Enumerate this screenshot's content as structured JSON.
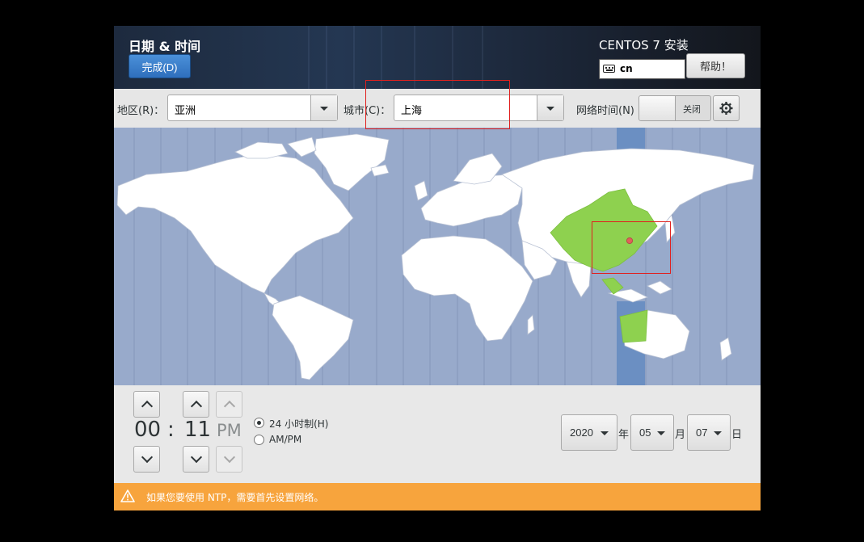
{
  "header": {
    "title": "日期 & 时间",
    "done_label": "完成(D)",
    "product_title": "CENTOS 7 安装",
    "keyboard_layout": "cn",
    "help_label": "帮助！"
  },
  "controls": {
    "region_label": "地区(R)：",
    "region_value": "亚洲",
    "city_label": "城市(C)：",
    "city_value": "上海",
    "network_time_label": "网络时间(N)",
    "network_time_state": "关闭",
    "network_time_on": false
  },
  "map": {
    "selected_city": "上海",
    "highlight_color": "#8ed14f",
    "ocean_color": "#98aacb",
    "land_color": "#ffffff",
    "current_zone_band_color": "#6b8fc2",
    "pin_color": "#e0625a"
  },
  "time": {
    "hours": "00",
    "separator": ":",
    "minutes": "11",
    "ampm": "PM",
    "format_24h_label": "24 小时制(H)",
    "format_ampm_label": "AM/PM",
    "format_24h_selected": true
  },
  "date": {
    "year": "2020",
    "year_unit": "年",
    "month": "05",
    "month_unit": "月",
    "day": "07",
    "day_unit": "日"
  },
  "warning": {
    "text": "如果您要使用 NTP，需要首先设置网络。",
    "color": "#f7a43d"
  }
}
